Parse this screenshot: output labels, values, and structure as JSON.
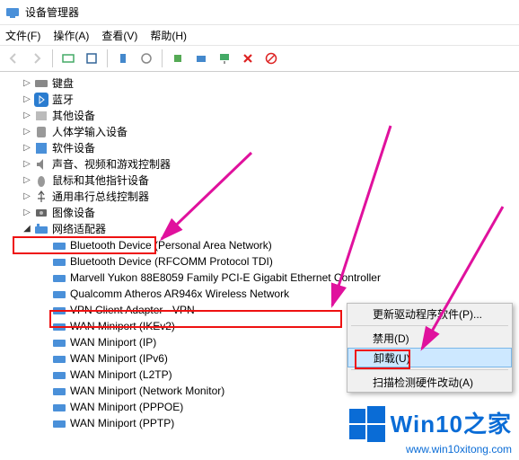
{
  "titlebar": {
    "title": "设备管理器"
  },
  "menubar": {
    "file": "文件(F)",
    "action": "操作(A)",
    "view": "查看(V)",
    "help": "帮助(H)"
  },
  "tree": {
    "categories": [
      {
        "name": "键盘",
        "icon": "keyboard"
      },
      {
        "name": "蓝牙",
        "icon": "bluetooth"
      },
      {
        "name": "其他设备",
        "icon": "other"
      },
      {
        "name": "人体学输入设备",
        "icon": "hid"
      },
      {
        "name": "软件设备",
        "icon": "software"
      },
      {
        "name": "声音、视频和游戏控制器",
        "icon": "sound"
      },
      {
        "name": "鼠标和其他指针设备",
        "icon": "mouse"
      },
      {
        "name": "通用串行总线控制器",
        "icon": "usb"
      },
      {
        "name": "图像设备",
        "icon": "image"
      }
    ],
    "expanded_cat": "网络适配器",
    "adapters": [
      "Bluetooth Device (Personal Area Network)",
      "Bluetooth Device (RFCOMM Protocol TDI)",
      "Marvell Yukon 88E8059 Family PCI-E Gigabit Ethernet Controller",
      "Qualcomm Atheros AR946x Wireless Network",
      "VPN Client Adapter - VPN",
      "WAN Miniport (IKEv2)",
      "WAN Miniport (IP)",
      "WAN Miniport (IPv6)",
      "WAN Miniport (L2TP)",
      "WAN Miniport (Network Monitor)",
      "WAN Miniport (PPPOE)",
      "WAN Miniport (PPTP)"
    ]
  },
  "context_menu": {
    "update_driver": "更新驱动程序软件(P)...",
    "disable": "禁用(D)",
    "uninstall": "卸载(U)",
    "scan": "扫描检测硬件改动(A)"
  },
  "watermark": {
    "brand": "Win10之家",
    "url": "www.win10xitong.com"
  }
}
